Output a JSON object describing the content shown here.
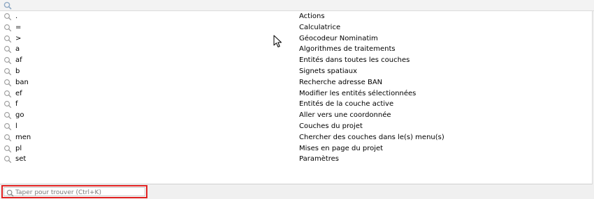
{
  "top_search": {
    "icon": "search-icon"
  },
  "locator_rows": [
    {
      "prefix": ".",
      "description": "Actions"
    },
    {
      "prefix": "=",
      "description": "Calculatrice"
    },
    {
      "prefix": ">",
      "description": "Géocodeur Nominatim"
    },
    {
      "prefix": "a",
      "description": "Algorithmes de traitements"
    },
    {
      "prefix": "af",
      "description": "Entités dans toutes les couches"
    },
    {
      "prefix": "b",
      "description": "Signets spatiaux"
    },
    {
      "prefix": "ban",
      "description": "Recherche adresse BAN"
    },
    {
      "prefix": "ef",
      "description": "Modifier les entités sélectionnées"
    },
    {
      "prefix": "f",
      "description": "Entités de la couche active"
    },
    {
      "prefix": "go",
      "description": "Aller vers une coordonnée"
    },
    {
      "prefix": "l",
      "description": "Couches du projet"
    },
    {
      "prefix": "men",
      "description": "Chercher des couches dans le(s) menu(s)"
    },
    {
      "prefix": "pl",
      "description": "Mises en page du projet"
    },
    {
      "prefix": "set",
      "description": "Paramètres"
    }
  ],
  "locator_bar": {
    "placeholder": "Taper pour trouver (Ctrl+K)",
    "value": "",
    "highlight_color": "#e02020"
  },
  "colors": {
    "icon": "#8fa9c4",
    "row_icon": "#9a9a9a"
  }
}
